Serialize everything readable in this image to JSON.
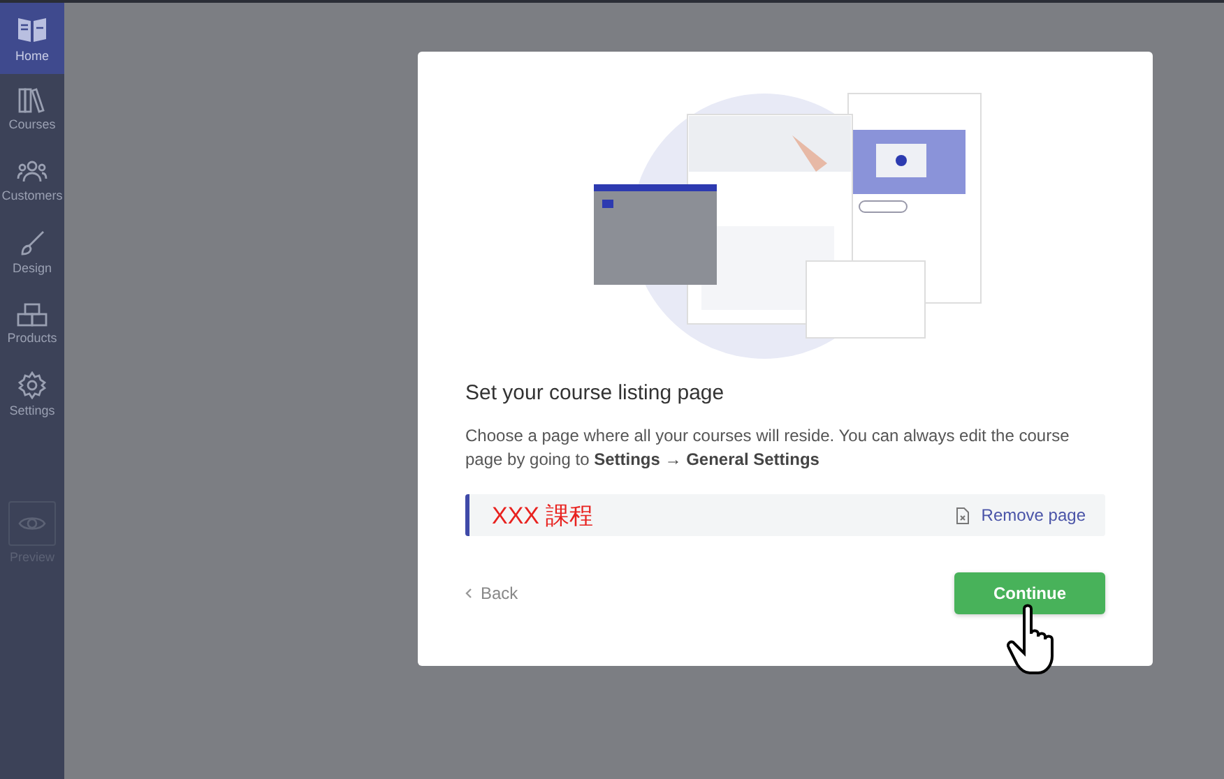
{
  "sidebar": {
    "items": [
      {
        "label": "Home",
        "selected": true
      },
      {
        "label": "Courses",
        "selected": false
      },
      {
        "label": "Customers",
        "selected": false
      },
      {
        "label": "Design",
        "selected": false
      },
      {
        "label": "Products",
        "selected": false
      },
      {
        "label": "Settings",
        "selected": false
      }
    ],
    "preview": {
      "label": "Preview",
      "disabled": true
    }
  },
  "dialog": {
    "title": "Set your course listing page",
    "description": "Choose a page where all your courses will reside. You can always edit the course page by going to **Settings → General Settings**",
    "selected_page": {
      "name": "XXX 課程",
      "remove_label": "Remove page"
    },
    "back_label": "Back",
    "continue_label": "Continue"
  }
}
